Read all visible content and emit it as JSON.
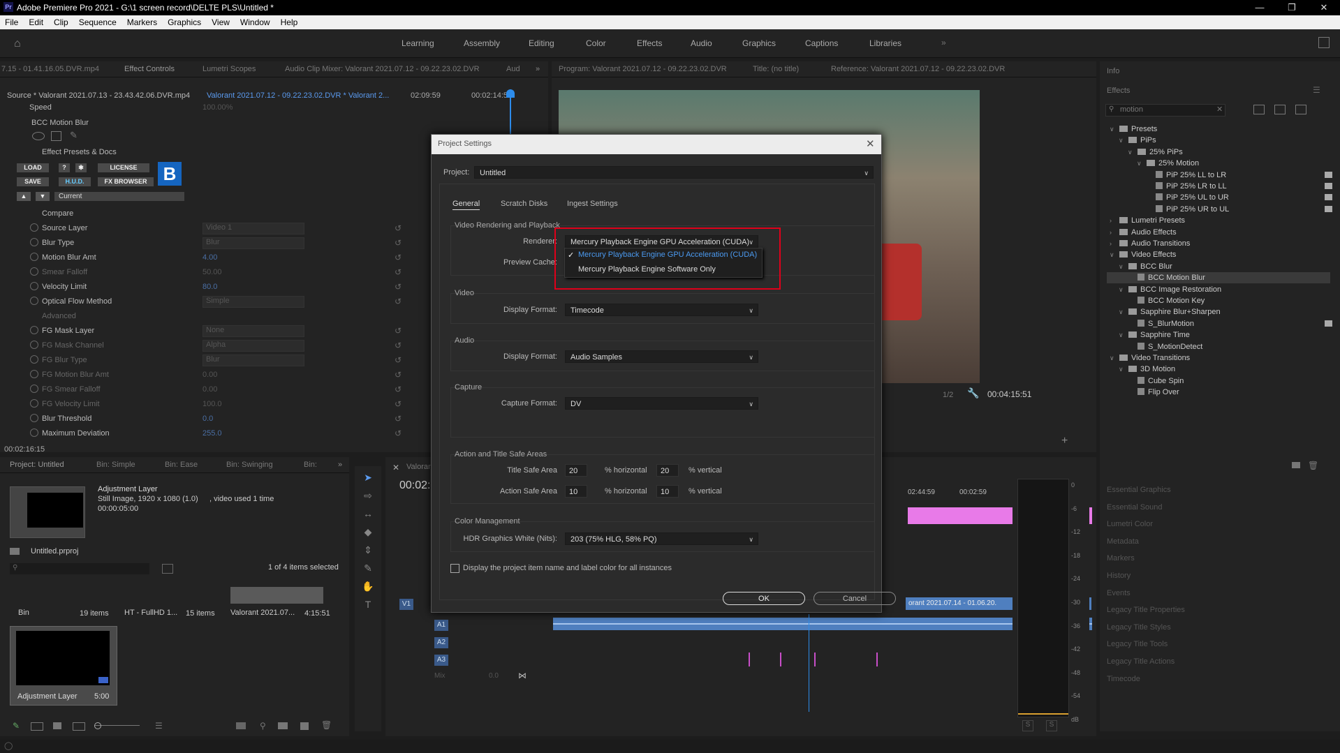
{
  "app": {
    "title": "Adobe Premiere Pro 2021 - G:\\1 screen record\\DELTE PLS\\Untitled *",
    "logo": "Pr",
    "window_controls": [
      "minimize-icon",
      "restore-icon",
      "close-icon"
    ]
  },
  "menu": [
    "File",
    "Edit",
    "Clip",
    "Sequence",
    "Markers",
    "Graphics",
    "View",
    "Window",
    "Help"
  ],
  "workspaces": [
    "Learning",
    "Assembly",
    "Editing",
    "Color",
    "Effects",
    "Audio",
    "Graphics",
    "Captions",
    "Libraries"
  ],
  "left_panel": {
    "tabs": [
      "7.15 - 01.41.16.05.DVR.mp4",
      "Effect Controls",
      "Lumetri Scopes",
      "Audio Clip Mixer: Valorant 2021.07.12 - 09.22.23.02.DVR",
      "Aud"
    ],
    "source": "Source * Valorant 2021.07.13 - 23.43.42.06.DVR.mp4",
    "sequence": "Valorant 2021.07.12 - 09.22.23.02.DVR * Valorant 2...",
    "timecodes": [
      "02:09:59",
      "00:02:14:59"
    ],
    "speed_label": "Speed",
    "speed_value": "100.00%",
    "effect_name": "BCC Motion Blur",
    "presets_label": "Effect Presets & Docs",
    "bcc_buttons": [
      "LOAD",
      "?",
      "✱",
      "LICENSE",
      "SAVE",
      "H.U.D.",
      "FX BROWSER"
    ],
    "current_label": "Current",
    "params": [
      {
        "label": "Compare",
        "value": "",
        "dis": false,
        "type": "text"
      },
      {
        "label": "Source Layer",
        "value": "Video 1",
        "dis": false,
        "type": "dd"
      },
      {
        "label": "Blur Type",
        "value": "Blur",
        "dis": false,
        "type": "dd"
      },
      {
        "label": "Motion Blur Amt",
        "value": "4.00",
        "dis": false,
        "type": "val"
      },
      {
        "label": "Smear Falloff",
        "value": "50.00",
        "dis": true,
        "type": "val"
      },
      {
        "label": "Velocity Limit",
        "value": "80.0",
        "dis": false,
        "type": "val"
      },
      {
        "label": "Optical Flow Method",
        "value": "Simple",
        "dis": false,
        "type": "dd"
      },
      {
        "label": "Advanced",
        "value": "",
        "dis": true,
        "type": "text"
      },
      {
        "label": "FG Mask Layer",
        "value": "None",
        "dis": false,
        "type": "dd"
      },
      {
        "label": "FG Mask Channel",
        "value": "Alpha",
        "dis": true,
        "type": "dd"
      },
      {
        "label": "FG Blur Type",
        "value": "Blur",
        "dis": true,
        "type": "dd"
      },
      {
        "label": "FG Motion Blur Amt",
        "value": "0.00",
        "dis": true,
        "type": "val"
      },
      {
        "label": "FG Smear Falloff",
        "value": "0.00",
        "dis": true,
        "type": "val"
      },
      {
        "label": "FG Velocity Limit",
        "value": "100.0",
        "dis": true,
        "type": "val"
      },
      {
        "label": "Blur Threshold",
        "value": "0.0",
        "dis": false,
        "type": "val"
      },
      {
        "label": "Maximum Deviation",
        "value": "255.0",
        "dis": false,
        "type": "val"
      }
    ],
    "bottom_timecode": "00:02:16:15"
  },
  "project_panel": {
    "tabs": [
      "Project: Untitled",
      "Bin: Simple",
      "Bin: Ease",
      "Bin: Swinging",
      "Bin:"
    ],
    "clip_name": "Adjustment Layer",
    "clip_info": "Still Image, 1920 x 1080 (1.0)",
    "clip_used": ", video used 1 time",
    "clip_duration": "00:00:05:00",
    "project_file": "Untitled.prproj",
    "selection_count": "1 of 4 items selected",
    "items": [
      {
        "name": "Bin",
        "count": "19 items"
      },
      {
        "name": "HT - FullHD 1...",
        "count": "15 items"
      },
      {
        "name": "Valorant 2021.07...",
        "count": "4:15:51"
      }
    ],
    "tile_label": "Adjustment Layer",
    "tile_duration": "5:00"
  },
  "program": {
    "tabs": [
      "Program: Valorant 2021.07.12 - 09.22.23.02.DVR",
      "Title: (no title)",
      "Reference: Valorant 2021.07.12 - 09.22.23.02.DVR"
    ],
    "scale": "1/2",
    "timecode": "00:04:15:51"
  },
  "timeline": {
    "timecode": "00:02:",
    "ruler": [
      "02:44:59",
      "00:02:59"
    ],
    "tracks_video": [
      "V1"
    ],
    "tracks_audio": [
      "A1",
      "A2",
      "A3"
    ],
    "mix_label": "Mix",
    "mix_value": "0.0",
    "clip_label": "orant 2021.07.14 - 01.06.20."
  },
  "meter_scale": [
    "0",
    "-6",
    "-12",
    "-18",
    "-24",
    "-30",
    "-36",
    "-42",
    "-48",
    "-54",
    "dB"
  ],
  "meter_solo": [
    "S",
    "S"
  ],
  "right_panel": {
    "info": "Info",
    "effects": "Effects",
    "search_value": "motion",
    "tree": [
      {
        "label": "Presets",
        "indent": 0,
        "icon": "folder",
        "open": true
      },
      {
        "label": "PiPs",
        "indent": 1,
        "icon": "folder",
        "open": true
      },
      {
        "label": "25% PiPs",
        "indent": 2,
        "icon": "folder",
        "open": true
      },
      {
        "label": "25% Motion",
        "indent": 3,
        "icon": "folder",
        "open": true
      },
      {
        "label": "PiP 25% LL to LR",
        "indent": 4,
        "icon": "fx",
        "badge": true
      },
      {
        "label": "PiP 25% LR to LL",
        "indent": 4,
        "icon": "fx",
        "badge": true
      },
      {
        "label": "PiP 25% UL to UR",
        "indent": 4,
        "icon": "fx",
        "badge": true
      },
      {
        "label": "PiP 25% UR to UL",
        "indent": 4,
        "icon": "fx",
        "badge": true
      },
      {
        "label": "Lumetri Presets",
        "indent": 0,
        "icon": "folder",
        "open": false
      },
      {
        "label": "Audio Effects",
        "indent": 0,
        "icon": "folder",
        "open": false
      },
      {
        "label": "Audio Transitions",
        "indent": 0,
        "icon": "folder",
        "open": false
      },
      {
        "label": "Video Effects",
        "indent": 0,
        "icon": "folder",
        "open": true
      },
      {
        "label": "BCC Blur",
        "indent": 1,
        "icon": "folder",
        "open": true
      },
      {
        "label": "BCC Motion Blur",
        "indent": 2,
        "icon": "fx",
        "selected": true
      },
      {
        "label": "BCC Image Restoration",
        "indent": 1,
        "icon": "folder",
        "open": true
      },
      {
        "label": "BCC Motion Key",
        "indent": 2,
        "icon": "fx"
      },
      {
        "label": "Sapphire Blur+Sharpen",
        "indent": 1,
        "icon": "folder",
        "open": true
      },
      {
        "label": "S_BlurMotion",
        "indent": 2,
        "icon": "fx",
        "badge": true
      },
      {
        "label": "Sapphire Time",
        "indent": 1,
        "icon": "folder",
        "open": true
      },
      {
        "label": "S_MotionDetect",
        "indent": 2,
        "icon": "fx"
      },
      {
        "label": "Video Transitions",
        "indent": 0,
        "icon": "folder",
        "open": true
      },
      {
        "label": "3D Motion",
        "indent": 1,
        "icon": "folder",
        "open": true
      },
      {
        "label": "Cube Spin",
        "indent": 2,
        "icon": "fx"
      },
      {
        "label": "Flip Over",
        "indent": 2,
        "icon": "fx"
      }
    ],
    "sections": [
      "Essential Graphics",
      "Essential Sound",
      "Lumetri Color",
      "Metadata",
      "Markers",
      "History",
      "Events",
      "Legacy Title Properties",
      "Legacy Title Styles",
      "Legacy Title Tools",
      "Legacy Title Actions",
      "Timecode"
    ]
  },
  "dialog": {
    "title": "Project Settings",
    "project_label": "Project:",
    "project_value": "Untitled",
    "tabs": [
      "General",
      "Scratch Disks",
      "Ingest Settings"
    ],
    "video_rendering": {
      "title": "Video Rendering and Playback",
      "renderer_label": "Renderer:",
      "renderer_value": "Mercury Playback Engine GPU Acceleration (CUDA)",
      "preview_cache_label": "Preview Cache:",
      "options": [
        "Mercury Playback Engine GPU Acceleration (CUDA)",
        "Mercury Playback Engine Software Only"
      ]
    },
    "video": {
      "title": "Video",
      "label": "Display Format:",
      "value": "Timecode"
    },
    "audio": {
      "title": "Audio",
      "label": "Display Format:",
      "value": "Audio Samples"
    },
    "capture": {
      "title": "Capture",
      "label": "Capture Format:",
      "value": "DV"
    },
    "safe_areas": {
      "title": "Action and Title Safe Areas",
      "title_label": "Title Safe Area",
      "title_h": "20",
      "title_v": "20",
      "action_label": "Action Safe Area",
      "action_h": "10",
      "action_v": "10",
      "h_label": "% horizontal",
      "v_label": "% vertical"
    },
    "color": {
      "title": "Color Management",
      "label": "HDR Graphics White (Nits):",
      "value": "203 (75% HLG, 58% PQ)"
    },
    "checkbox_label": "Display the project item name and label color for all instances",
    "ok": "OK",
    "cancel": "Cancel"
  },
  "colors": {
    "accent": "#2d8ceb",
    "highlight": "#e0001a",
    "selected_row": "#3a3a3a",
    "clip_pink": "#e87ae8",
    "audio_clip": "#4f7fbf"
  }
}
